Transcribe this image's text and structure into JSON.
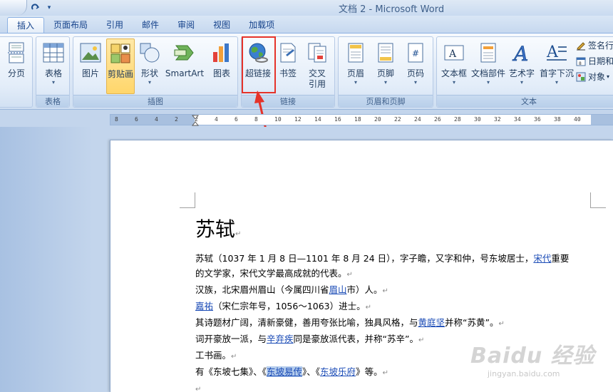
{
  "window": {
    "title": "文档 2 - Microsoft Word"
  },
  "quick_access": {
    "redo_icon": "redo-icon",
    "customize_icon": "dropdown-icon"
  },
  "tabs": [
    {
      "label": "插入",
      "active": true
    },
    {
      "label": "页面布局"
    },
    {
      "label": "引用"
    },
    {
      "label": "邮件"
    },
    {
      "label": "审阅"
    },
    {
      "label": "视图"
    },
    {
      "label": "加载项"
    }
  ],
  "ribbon": {
    "groups": {
      "pages": {
        "label": ""
      },
      "tables": {
        "label": "表格"
      },
      "illustrations": {
        "label": "插图"
      },
      "links": {
        "label": "链接"
      },
      "header_footer": {
        "label": "页眉和页脚"
      },
      "text": {
        "label": "文本"
      }
    },
    "buttons": {
      "page_break": "分页",
      "table": "表格",
      "picture": "图片",
      "clipart": "剪贴画",
      "shapes": "形状",
      "smartart": "SmartArt",
      "chart": "图表",
      "hyperlink": "超链接",
      "bookmark": "书签",
      "cross_ref_1": "交叉",
      "cross_ref_2": "引用",
      "header": "页眉",
      "footer": "页脚",
      "page_number": "页码",
      "textbox": "文本框",
      "quickparts": "文档部件",
      "wordart": "艺术字",
      "dropcap": "首字下沉",
      "signature": "签名行",
      "datetime": "日期和",
      "object": "对象"
    }
  },
  "ruler": {
    "ticks": [
      "8",
      "6",
      "4",
      "2",
      "2",
      "4",
      "6",
      "8",
      "10",
      "12",
      "14",
      "16",
      "18",
      "20",
      "22",
      "24",
      "26",
      "28",
      "30",
      "32",
      "34",
      "36",
      "38",
      "40"
    ]
  },
  "document": {
    "heading": "苏轼",
    "lines": {
      "l1a": "苏轼（1037 年 1 月 8 日—1101 年 8 月 24 日），字子瞻，又字和仲，号东坡居士，",
      "l1link": "宋代",
      "l1b": "重要",
      "l2": "的文学家，宋代文学最高成就的代表。",
      "l3a": "汉族，北宋眉州眉山（今属四川省",
      "l3link": "眉山",
      "l3b": "市）人。",
      "l4link": "嘉祐",
      "l4b": "（宋仁宗年号，1056～1063）进士",
      "l4c": "。",
      "l5a": "其诗题材广阔，清新豪健，善用夸张比喻，独具风格，与",
      "l5link": "黄庭坚",
      "l5b": "并称“苏黄”。",
      "l6a": "词开豪放一派，与",
      "l6link": "辛弃疾",
      "l6b": "同是豪放派代表，并称“苏辛”。",
      "l7": "工书画。",
      "l8a": "有《东坡七集》、《",
      "l8sel": "东坡易传",
      "l8b": "》、《",
      "l8link": "东坡乐府",
      "l8c": "》等。"
    },
    "para_mark": "↵"
  },
  "watermark": {
    "brand": "Baidu 经验",
    "url": "jingyan.baidu.com"
  },
  "colors": {
    "accent": "#15428b",
    "highlight": "#e5332a",
    "link": "#1a4bb6"
  }
}
